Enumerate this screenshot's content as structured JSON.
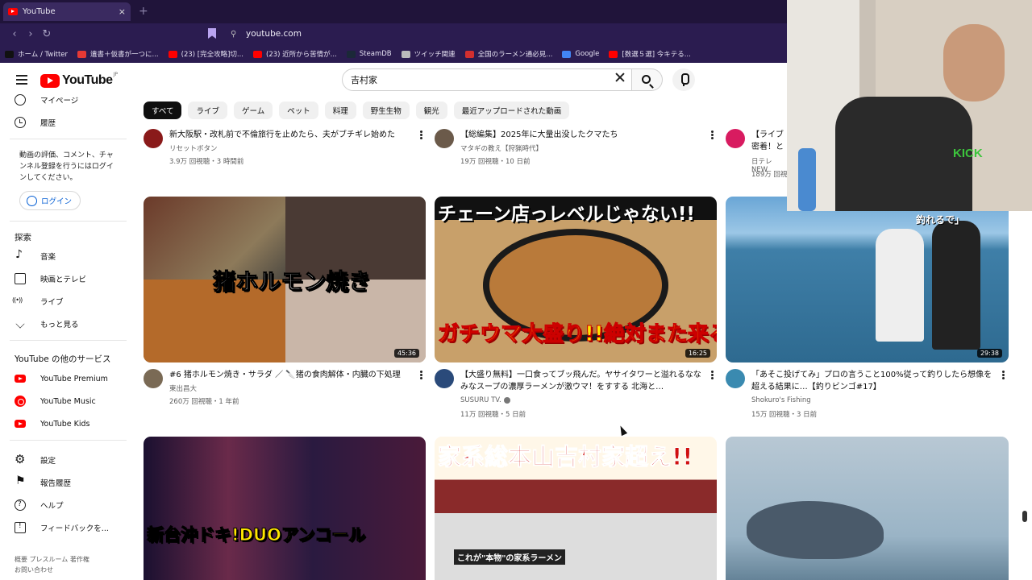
{
  "browser": {
    "tab_title": "YouTube",
    "tab_close": "×",
    "new_tab": "+",
    "url": "youtube.com",
    "bookmarks": [
      {
        "label": "ホーム / Twitter",
        "color": "#111111"
      },
      {
        "label": "遺書＋仮書が一つに...",
        "color": "#e53935"
      },
      {
        "label": "(23) [完全攻略]切...",
        "color": "#ff0000"
      },
      {
        "label": "(23) 近所から苦情が...",
        "color": "#ff0000"
      },
      {
        "label": "SteamDB",
        "color": "#1b2838"
      },
      {
        "label": "ツイッチ関連",
        "color": "#bbbbbb"
      },
      {
        "label": "全国のラーメン通必見...",
        "color": "#d32f2f"
      },
      {
        "label": "Google",
        "color": "#4285f4"
      },
      {
        "label": "[数選５選] 今キテる...",
        "color": "#ff0000"
      }
    ]
  },
  "youtube": {
    "logo_text": "YouTube",
    "logo_region": "JP",
    "search_value": "吉村家",
    "sidebar": {
      "top_items": [
        {
          "label": "マイページ",
          "icon": "account-icon"
        },
        {
          "label": "履歴",
          "icon": "history-icon"
        }
      ],
      "signin_note": "動画の評価、コメント、チャンネル登録を行うにはログインしてください。",
      "login_label": "ログイン",
      "explore_heading": "探索",
      "explore_items": [
        {
          "label": "音楽",
          "icon": "music-note-icon"
        },
        {
          "label": "映画とテレビ",
          "icon": "film-icon"
        },
        {
          "label": "ライブ",
          "icon": "live-icon"
        },
        {
          "label": "もっと見る",
          "icon": "chevron-down-icon"
        }
      ],
      "more_heading": "YouTube の他のサービス",
      "more_items": [
        {
          "label": "YouTube Premium",
          "icon": "youtube-premium-icon"
        },
        {
          "label": "YouTube Music",
          "icon": "youtube-music-icon"
        },
        {
          "label": "YouTube Kids",
          "icon": "youtube-kids-icon"
        }
      ],
      "bottom_items": [
        {
          "label": "設定",
          "icon": "gear-icon"
        },
        {
          "label": "報告履歴",
          "icon": "flag-icon"
        },
        {
          "label": "ヘルプ",
          "icon": "help-icon"
        },
        {
          "label": "フィードバックを...",
          "icon": "feedback-icon"
        }
      ],
      "footer_line1": "概要  プレスルーム  著作権",
      "footer_line2": "お問い合わせ"
    },
    "chips": [
      "すべて",
      "ライブ",
      "ゲーム",
      "ペット",
      "料理",
      "野生生物",
      "観光",
      "最近アップロードされた動画"
    ],
    "row0": [
      {
        "title": "新大阪駅・改札前で不倫旅行を止めたら、夫がブチギレ始めた",
        "channel": "リセットボタン",
        "stats": "3.9万 回視聴・3 時間前",
        "avatar_color": "#8a1a1a"
      },
      {
        "title": "【総編集】2025年に大量出没したクマたち",
        "channel": "マタギの教え【狩猟時代】",
        "stats": "19万 回視聴・10 日前",
        "avatar_color": "#6b5a4a"
      },
      {
        "title": "【ライブ 密着！と",
        "channel": "日テレNEW",
        "stats": "189万 回視",
        "avatar_color": "#d81b60"
      }
    ],
    "row1": [
      {
        "title": "#6 猪ホルモン焼き・サラダ ／ 🔪猪の食肉解体・内臓の下処理",
        "channel": "東出昌大",
        "stats": "260万 回視聴・1 年前",
        "duration": "45:36",
        "thumb_text": "猪ホルモン焼き",
        "avatar_color": "#7a6a55"
      },
      {
        "title": "【大盛り無料】一口食ってブッ飛んだ。ヤサイタワーと溢れるななみなスープの濃厚ラーメンが激ウマ！をすする 北海と…",
        "channel": "SUSURU TV.",
        "stats": "11万 回視聴・5 日前",
        "duration": "16:25",
        "thumb_text_top": "チェーン店っレベルじゃない!!",
        "thumb_text_bottom": "ガチウマ大盛り!!絶対また来る",
        "avatar_color": "#2a4a7a"
      },
      {
        "title": "「あそこ投げてみ」プロの言うこと100%従って釣りしたら想像を超える結果に…【釣りビンゴ#17】",
        "channel": "Shokuro's Fishing",
        "stats": "15万 回視聴・3 日前",
        "duration": "29:38",
        "thumb_text": "釣れるで」",
        "avatar_color": "#3a8ab0"
      }
    ],
    "row2": [
      {
        "thumb_text": "新台沖ドキ!DUOアンコール"
      },
      {
        "thumb_text": "家系総本山吉村家超え!!",
        "thumb_sub": "これが\"本物\"の家系ラーメン"
      },
      {
        "thumb_text": ""
      }
    ]
  },
  "colors": {
    "brand_red": "#ff0000",
    "link_blue": "#065fd4",
    "browser_purple": "#2b1c50"
  }
}
